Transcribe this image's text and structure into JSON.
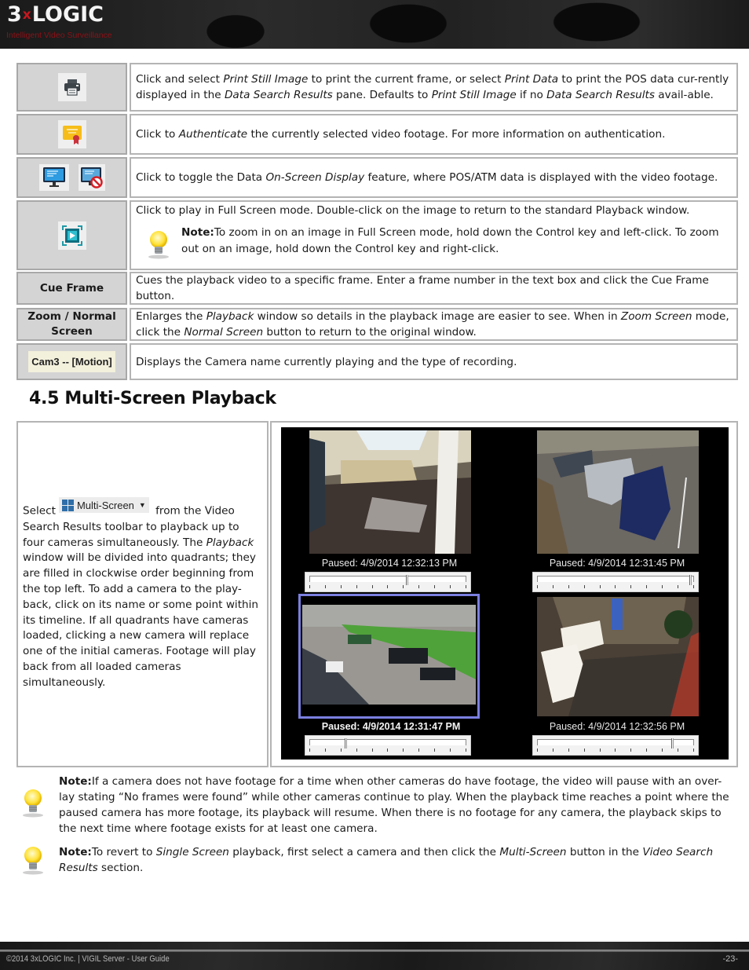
{
  "header": {
    "logo_left": "3",
    "logo_x": "x",
    "logo_right": "LOGIC",
    "tagline": "Intelligent Video Surveillance"
  },
  "table": {
    "rows": [
      {
        "icon": "printer-icon",
        "parts": [
          {
            "t": "Click and select "
          },
          {
            "t": "Print Still Image",
            "i": true
          },
          {
            "t": " to print the current frame, or select "
          },
          {
            "t": "Print Data",
            "i": true
          },
          {
            "t": " to print the POS data cur-rently displayed in the "
          },
          {
            "t": "Data Search Results",
            "i": true
          },
          {
            "t": " pane.  Defaults to "
          },
          {
            "t": "Print Still Image",
            "i": true
          },
          {
            "t": " if no "
          },
          {
            "t": "Data Search Results",
            "i": true
          },
          {
            "t": " avail-able."
          }
        ]
      },
      {
        "icon": "certificate-icon",
        "parts": [
          {
            "t": "Click to "
          },
          {
            "t": "Authenticate",
            "i": true
          },
          {
            "t": " the currently selected video footage. For more information on authentication."
          }
        ]
      },
      {
        "icons": [
          "monitor-osd-on-icon",
          "monitor-osd-off-icon"
        ],
        "parts": [
          {
            "t": "Click to toggle the Data "
          },
          {
            "t": "On-Screen Display",
            "i": true
          },
          {
            "t": " feature, where POS/ATM data is displayed with the video footage."
          }
        ]
      },
      {
        "icon": "fullscreen-play-icon",
        "text": "Click to play in Full Screen mode. Double-click on the image to return to the standard Playback window.",
        "note_label": "Note:",
        "note_text": "To zoom in on an image in Full Screen mode, hold down the Control key and left-click. To zoom out on an image, hold down the Control key and right-click."
      },
      {
        "label": "Cue Frame",
        "parts": [
          {
            "t": "Cues the playback video to a specific frame. Enter a frame number in the text box and click the Cue Frame button."
          }
        ]
      },
      {
        "label": "Zoom / Normal Screen",
        "parts": [
          {
            "t": "Enlarges the "
          },
          {
            "t": "Playback",
            "i": true
          },
          {
            "t": " window so details in the playback image are easier to see. When in "
          },
          {
            "t": "Zoom Screen",
            "i": true
          },
          {
            "t": " mode, click the "
          },
          {
            "t": "Normal Screen",
            "i": true
          },
          {
            "t": " button to return to the original window."
          }
        ]
      },
      {
        "badge": "Cam3 -- [Motion]",
        "parts": [
          {
            "t": "Displays the Camera name currently playing and the type of recording."
          }
        ]
      }
    ]
  },
  "section": {
    "title": "4.5 Multi-Screen Playback",
    "select_word": "Select",
    "button_label": "Multi-Screen",
    "parts": [
      {
        "t": " from the Video Search Results toolbar to playback up to four cameras simultaneously. The "
      },
      {
        "t": "Playback",
        "i": true
      },
      {
        "t": " window will be divided into quadrants; they are filled in clockwise order beginning from the top left. To add a camera to the play-back, click on its name or some point within its timeline. If all quadrants have cameras loaded, clicking a new camera will replace one of the initial cameras. Footage will play back from all loaded cameras simultaneously."
      }
    ]
  },
  "playback": {
    "quadrants": [
      {
        "name": "stairwell-camera",
        "status": "Paused: 4/9/2014 12:32:13 PM",
        "position": 0.63,
        "selected": false
      },
      {
        "name": "parking-lot-camera",
        "status": "Paused: 4/9/2014 12:31:45 PM",
        "position": 0.99,
        "selected": false
      },
      {
        "name": "lot-overview-camera",
        "status": "Paused: 4/9/2014 12:31:47 PM",
        "position": 0.23,
        "selected": true
      },
      {
        "name": "lobby-camera",
        "status": "Paused: 4/9/2014 12:32:56 PM",
        "position": 0.87,
        "selected": false
      }
    ],
    "selected_border_color": "#7b7fe0"
  },
  "notes": [
    {
      "label": "Note:",
      "parts": [
        {
          "t": "If a camera does not have footage for a time when other cameras do have footage, the video will pause with an over-lay stating “No frames were found” while other cameras continue to play. When the playback time reaches a point where the paused camera has more footage, its playback will resume. When there is no footage for any camera, the playback skips to the next time where footage exists for at least one camera."
        }
      ]
    },
    {
      "label": "Note:",
      "parts": [
        {
          "t": "To revert to "
        },
        {
          "t": "Single Screen",
          "i": true
        },
        {
          "t": " playback, first select a camera and then click the "
        },
        {
          "t": "Multi-Screen",
          "i": true
        },
        {
          "t": " button in the "
        },
        {
          "t": "Video Search Results",
          "i": true
        },
        {
          "t": " section."
        }
      ]
    }
  ],
  "footer": {
    "left": "©2014 3xLOGIC Inc.  |  VIGIL Server - User Guide",
    "page": "-23-"
  }
}
